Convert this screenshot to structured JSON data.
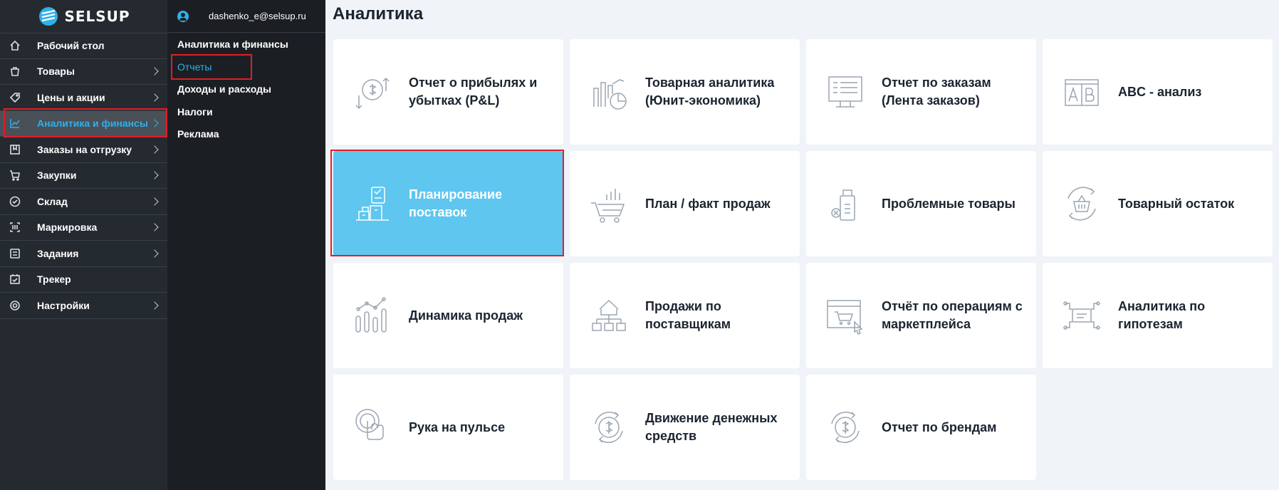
{
  "app": {
    "logo_text": "SELSUP"
  },
  "sidebar": {
    "items": [
      {
        "label": "Рабочий стол",
        "icon": "home-icon"
      },
      {
        "label": "Товары",
        "icon": "bag-icon"
      },
      {
        "label": "Цены и акции",
        "icon": "tag-icon"
      },
      {
        "label": "Аналитика и финансы",
        "icon": "chart-icon"
      },
      {
        "label": "Заказы на отгрузку",
        "icon": "box-icon"
      },
      {
        "label": "Закупки",
        "icon": "cart-icon"
      },
      {
        "label": "Склад",
        "icon": "check-circle-icon"
      },
      {
        "label": "Маркировка",
        "icon": "barcode-icon"
      },
      {
        "label": "Задания",
        "icon": "tasks-icon"
      },
      {
        "label": "Трекер",
        "icon": "calendar-check-icon"
      },
      {
        "label": "Настройки",
        "icon": "gear-icon"
      }
    ]
  },
  "submenu": {
    "user_email": "dashenko_e@selsup.ru",
    "title": "Аналитика и финансы",
    "items": [
      {
        "label": "Отчеты"
      },
      {
        "label": "Доходы и расходы"
      },
      {
        "label": "Налоги"
      },
      {
        "label": "Реклама"
      }
    ]
  },
  "main": {
    "title": "Аналитика",
    "cards": [
      {
        "label": "Отчет о прибылях и убытках (P&L)",
        "icon": "profit-loss-icon"
      },
      {
        "label": "Товарная аналитика (Юнит-экономика)",
        "icon": "unit-economics-icon"
      },
      {
        "label": "Отчет по заказам (Лента заказов)",
        "icon": "orders-feed-icon"
      },
      {
        "label": "ABC - анализ",
        "icon": "abc-analysis-icon"
      },
      {
        "label": "Планирование поставок",
        "icon": "supply-planning-icon"
      },
      {
        "label": "План / факт продаж",
        "icon": "plan-fact-icon"
      },
      {
        "label": "Проблемные товары",
        "icon": "problem-goods-icon"
      },
      {
        "label": "Товарный остаток",
        "icon": "stock-balance-icon"
      },
      {
        "label": "Динамика продаж",
        "icon": "sales-dynamics-icon"
      },
      {
        "label": "Продажи по поставщикам",
        "icon": "suppliers-sales-icon"
      },
      {
        "label": "Отчёт по операциям с маркетплейса",
        "icon": "marketplace-ops-icon"
      },
      {
        "label": "Аналитика по гипотезам",
        "icon": "hypotheses-icon"
      },
      {
        "label": "Рука на пульсе",
        "icon": "hand-pulse-icon"
      },
      {
        "label": "Движение денежных средств",
        "icon": "cash-flow-icon"
      },
      {
        "label": "Отчет по брендам",
        "icon": "brands-report-icon"
      }
    ]
  },
  "colors": {
    "sidebar_bg": "#252a30",
    "accent": "#2fb0ea",
    "selected_card": "#5ec6ef",
    "highlight": "#e01e26"
  }
}
